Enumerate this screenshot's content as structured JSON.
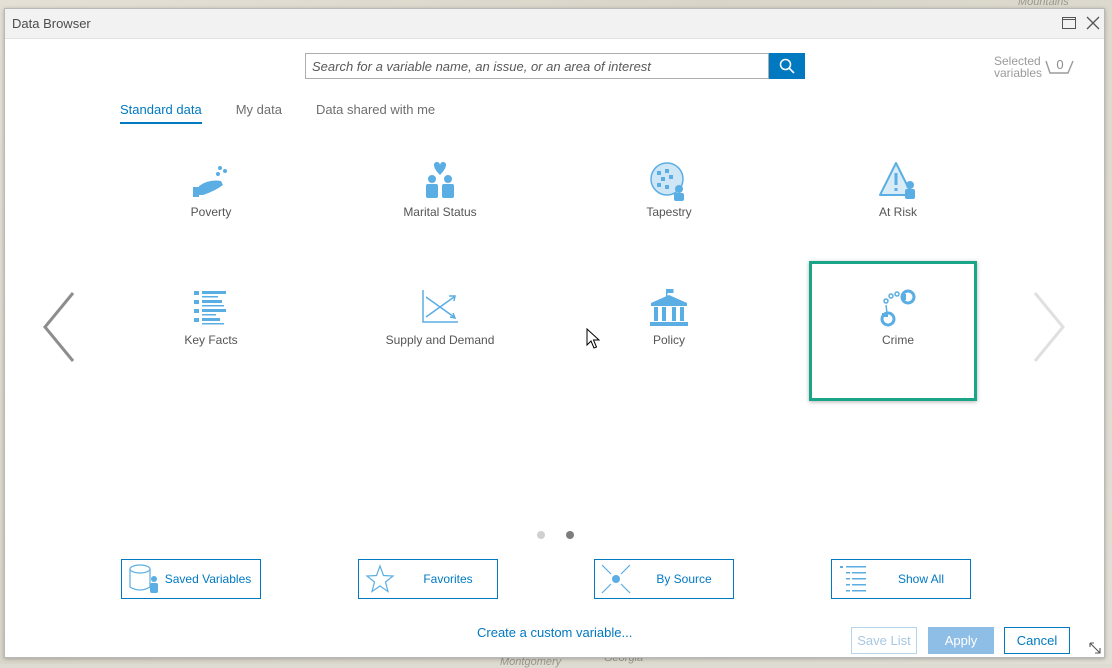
{
  "window": {
    "title": "Data Browser"
  },
  "search": {
    "placeholder": "Search for a variable name, an issue, or an area of interest"
  },
  "selected": {
    "line1": "Selected",
    "line2": "variables",
    "count": "0"
  },
  "tabs": [
    {
      "label": "Standard data",
      "active": true
    },
    {
      "label": "My data",
      "active": false
    },
    {
      "label": "Data shared with me",
      "active": false
    }
  ],
  "categories": [
    {
      "label": "Poverty",
      "icon": "poverty-icon"
    },
    {
      "label": "Marital Status",
      "icon": "marital-status-icon"
    },
    {
      "label": "Tapestry",
      "icon": "tapestry-icon"
    },
    {
      "label": "At Risk",
      "icon": "at-risk-icon"
    },
    {
      "label": "Key Facts",
      "icon": "key-facts-icon"
    },
    {
      "label": "Supply and Demand",
      "icon": "supply-demand-icon"
    },
    {
      "label": "Policy",
      "icon": "policy-icon"
    },
    {
      "label": "Crime",
      "icon": "handcuffs-icon",
      "selected": true
    }
  ],
  "pagination": {
    "pages": 2,
    "current": 2
  },
  "browse_buttons": [
    {
      "label": "Saved Variables",
      "icon": "saved-variables-icon"
    },
    {
      "label": "Favorites",
      "icon": "star-icon"
    },
    {
      "label": "By Source",
      "icon": "by-source-icon"
    },
    {
      "label": "Show All",
      "icon": "list-icon"
    }
  ],
  "footer": {
    "custom_link": "Create a custom variable...",
    "save_list": "Save List",
    "apply": "Apply",
    "cancel": "Cancel"
  },
  "colors": {
    "accent": "#0079c1",
    "icon": "#5aaee3",
    "highlight": "#1ba588"
  },
  "map_labels": {
    "top_right": "Mountains",
    "bottom_center": "Georgia",
    "bottom_left": "Montgomery"
  }
}
